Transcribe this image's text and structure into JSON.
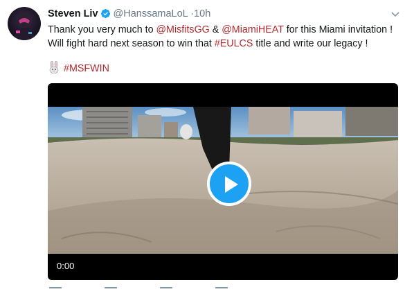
{
  "author": {
    "name": "Steven Liv",
    "handle": "@HanssamaLoL",
    "separator": "·",
    "time": "10h"
  },
  "tweet": {
    "line1": {
      "pre": "Thank you very much to ",
      "mention1": "@MisfitsGG",
      "mid": " & ",
      "mention2": "@MiamiHEAT",
      "post": " for this Miami invitation !"
    },
    "line2": {
      "pre": "Will fight hard next season to win that ",
      "hashtag": "#EULCS",
      "post": " title and write our legacy !"
    },
    "hashtag_line": "#MSFWIN"
  },
  "video": {
    "timestamp": "0:00"
  },
  "colors": {
    "link": "#b5292e",
    "verified": "#1da1f2",
    "play_button": "#1da1f2",
    "muted_text": "#657786"
  },
  "icons": {
    "verified": "verified-badge-icon",
    "caret": "chevron-down-icon",
    "emoji": "rabbit-emoji-icon",
    "play": "play-icon"
  }
}
